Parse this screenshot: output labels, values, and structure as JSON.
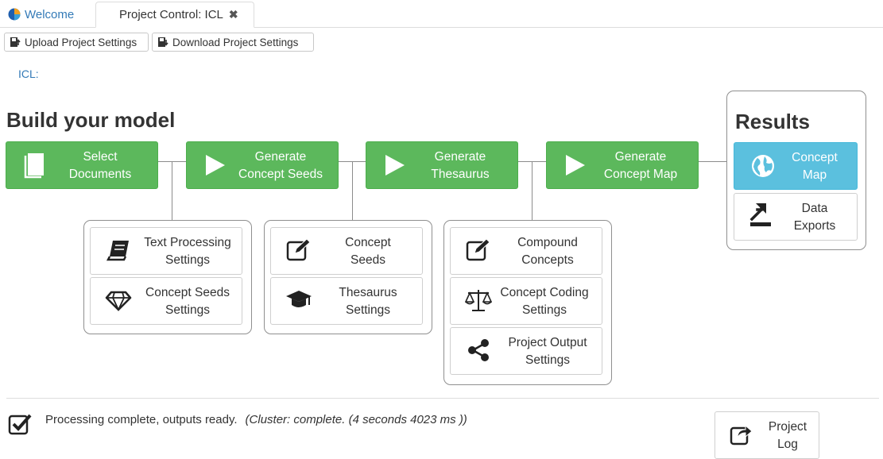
{
  "tabs": {
    "welcome": "Welcome",
    "project": "Project Control: ICL"
  },
  "toolbar": {
    "upload": "Upload Project Settings",
    "download": "Download Project Settings"
  },
  "project_name": "ICL:",
  "build_heading": "Build your model",
  "results_heading": "Results",
  "steps": {
    "select_documents": [
      "Select",
      "Documents"
    ],
    "generate_concept_seeds": [
      "Generate",
      "Concept Seeds"
    ],
    "generate_thesaurus": [
      "Generate",
      "Thesaurus"
    ],
    "generate_concept_map": [
      "Generate",
      "Concept Map"
    ]
  },
  "settings": {
    "text_processing": [
      "Text Processing",
      "Settings"
    ],
    "concept_seeds_settings": [
      "Concept Seeds",
      "Settings"
    ],
    "concept_seeds": [
      "Concept",
      "Seeds"
    ],
    "thesaurus_settings": [
      "Thesaurus",
      "Settings"
    ],
    "compound_concepts": [
      "Compound",
      "Concepts"
    ],
    "concept_coding": [
      "Concept Coding",
      "Settings"
    ],
    "project_output": [
      "Project Output",
      "Settings"
    ]
  },
  "results": {
    "concept_map": [
      "Concept",
      "Map"
    ],
    "data_exports": [
      "Data",
      "Exports"
    ]
  },
  "status": {
    "message": "Processing complete, outputs ready.",
    "detail": "(Cluster: complete. (4 seconds 4023 ms ))"
  },
  "project_log": [
    "Project",
    "Log"
  ],
  "colors": {
    "green": "#5cb85c",
    "blue": "#5bc0de",
    "link": "#337ab7"
  }
}
